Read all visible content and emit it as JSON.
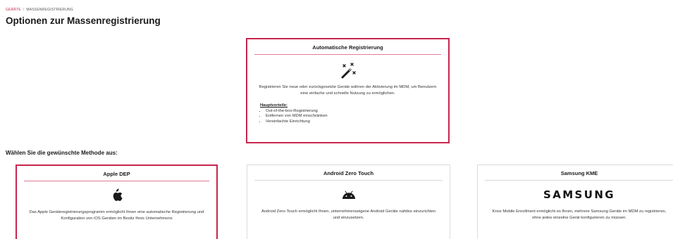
{
  "breadcrumb": {
    "parent": "GERÄTE",
    "separator": "/",
    "current": "MASSENREGISTRIERUNG"
  },
  "page": {
    "title": "Optionen zur Massenregistrierung"
  },
  "auto_registration": {
    "title": "Automatische Registrierung",
    "icon": "magic-wand-icon",
    "description": "Registrieren Sie neue oder zurückgesetzte Geräte währen der Aktivierung im MDM, um Benutzern eine einfache und schnelle Nutzung zu ermöglichen.",
    "benefits_title": "Hauptvorteile:",
    "benefits": [
      "Out-of-the-box-Registrierung",
      "Entfernen von MDM einschränken",
      "Vereinfachte Einrichtung"
    ]
  },
  "section": {
    "label": "Wählen Sie die gewünschte Methode aus:"
  },
  "methods": [
    {
      "title": "Apple DEP",
      "icon": "apple-icon",
      "description": "Das Apple Geräteregistrierungsprogramm ermöglicht Ihnen eine automatische Registrierung und Konfiguration von iOS Geräten im Besitz Ihres Unternehmens",
      "selected": true
    },
    {
      "title": "Android Zero Touch",
      "icon": "android-icon",
      "description": "Android Zero-Touch ermöglicht Ihnen, unternehmenseigene Android Geräte nahtlos einzurichten und einzusetzen.",
      "selected": false
    },
    {
      "title": "Samsung KME",
      "icon": "samsung-logo",
      "logo_text": "SAMSUNG",
      "description": "Knox Mobile Enrollment ermöglicht es Ihnen, mehrere Samsung Geräte im MDM zu registrieren, ohne jedes einzelne Gerät konfigurieren zu müssen.",
      "selected": false
    }
  ],
  "colors": {
    "accent": "#c8254e",
    "border": "#dcdcdc",
    "text": "#1a1a1a"
  }
}
